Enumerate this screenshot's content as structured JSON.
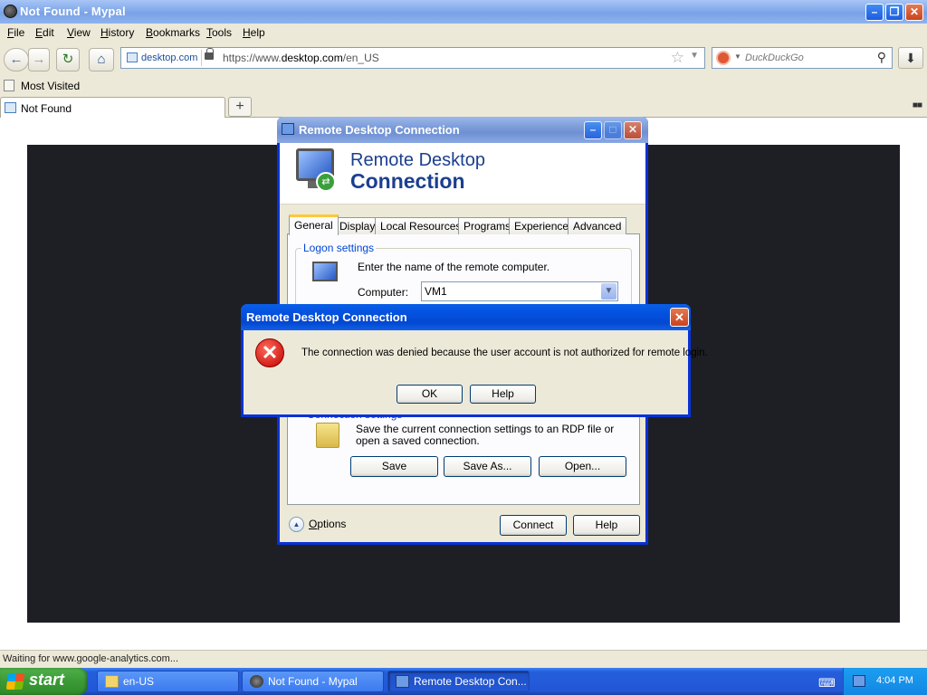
{
  "browser": {
    "title": "Not Found - Mypal",
    "menu": [
      "File",
      "Edit",
      "View",
      "History",
      "Bookmarks",
      "Tools",
      "Help"
    ],
    "identity": "desktop.com",
    "url_prefix": "https://www.",
    "url_domain": "desktop.com",
    "url_path": "/en_US",
    "search_placeholder": "DuckDuckGo",
    "bookmarks_label": "Most Visited",
    "tab_title": "Not Found",
    "new_tab": "+",
    "status": "Waiting for www.google-analytics.com..."
  },
  "rdc": {
    "title": "Remote Desktop Connection",
    "banner_line1": "Remote Desktop",
    "banner_line2": "Connection",
    "tabs": [
      "General",
      "Display",
      "Local Resources",
      "Programs",
      "Experience",
      "Advanced"
    ],
    "active_tab": "General",
    "logon_group": "Logon settings",
    "logon_text": "Enter the name of the remote computer.",
    "computer_label": "Computer:",
    "computer_value": "VM1",
    "conn_group": "Connection settings",
    "conn_text": "Save the current connection settings to an RDP file or open a saved connection.",
    "save": "Save",
    "save_as": "Save As...",
    "open": "Open...",
    "options": "Options",
    "connect": "Connect",
    "help": "Help"
  },
  "error_dialog": {
    "title": "Remote Desktop Connection",
    "message": "The connection was denied because the user account is not authorized for remote login.",
    "ok": "OK",
    "help": "Help"
  },
  "taskbar": {
    "start": "start",
    "tasks": [
      "en-US",
      "Not Found - Mypal",
      "Remote Desktop Con..."
    ],
    "clock": "4:04 PM"
  }
}
